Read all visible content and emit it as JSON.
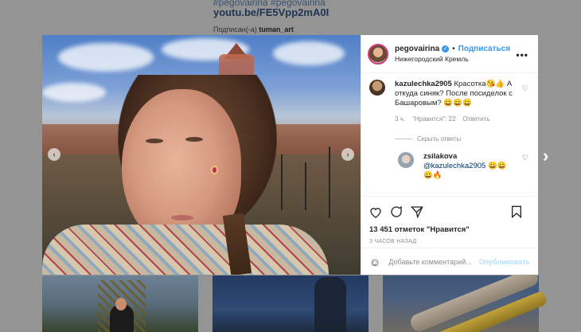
{
  "background": {
    "hashtag_line": "#pegovairina #pegovairina",
    "link": "youtu.be/FE5Vpp2mA0I",
    "tagged_prefix": "Подписан(-а)",
    "tagged_user": "tuman_art"
  },
  "post": {
    "username": "pegovairina",
    "follow_label": "Подписаться",
    "location": "Нижегородский Кремль",
    "more_icon": "more-horizontal-icon"
  },
  "comments": [
    {
      "user": "kazulechka2905",
      "text": "Красотка😘👍 А откуда синяк? После посиделок с Башаровым? 😀😀😀",
      "time": "3 ч.",
      "likes": "\"Нравится\": 22",
      "reply": "Ответить"
    }
  ],
  "hide_replies": "Скрыть ответы",
  "reply": {
    "user": "zsilakova",
    "mention": "@kazulechka2905",
    "text": "😀😀😀🔥"
  },
  "likes_text": "13 451 отметок \"Нравится\"",
  "time_ago": "3 ЧАСОВ НАЗАД",
  "add_comment_placeholder": "Добавьте комментарий...",
  "post_button": "Опубликовать",
  "colors": {
    "accent": "#3897f0",
    "avatar_ring": "#d13a7b"
  }
}
